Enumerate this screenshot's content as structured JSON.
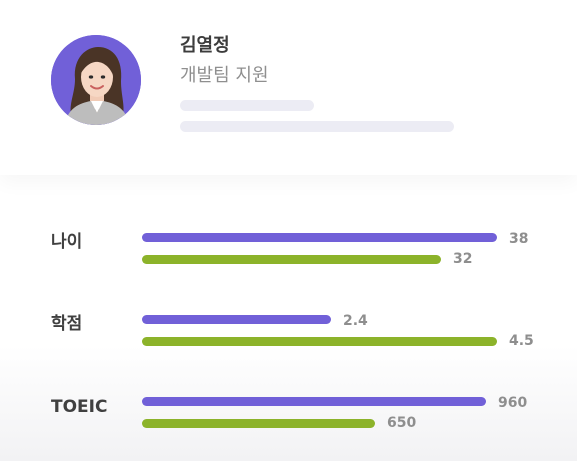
{
  "profile": {
    "name": "김열정",
    "role": "개발팀 지원",
    "avatar_bg_color": "#7160d8"
  },
  "colors": {
    "series_a": "#7160d8",
    "series_b": "#8cb32a"
  },
  "chart_data": {
    "type": "bar",
    "orientation": "horizontal",
    "categories": [
      "나이",
      "학점",
      "TOEIC"
    ],
    "rows": [
      {
        "label": "나이",
        "values": [
          38,
          32
        ],
        "max": 38
      },
      {
        "label": "학점",
        "values": [
          2.4,
          4.5
        ],
        "max": 4.5
      },
      {
        "label": "TOEIC",
        "values": [
          960,
          650
        ],
        "max": 990
      }
    ],
    "value_labels": [
      [
        "38",
        "32"
      ],
      [
        "2.4",
        "4.5"
      ],
      [
        "960",
        "650"
      ]
    ]
  }
}
